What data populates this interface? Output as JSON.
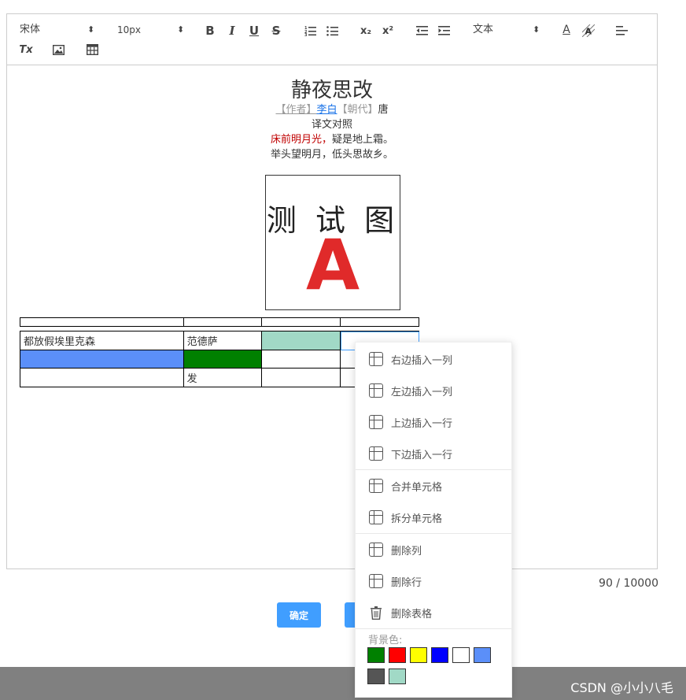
{
  "toolbar": {
    "font_family": "宋体",
    "font_size": "10px",
    "heading": "文本",
    "icons": [
      "bold-icon",
      "italic-icon",
      "underline-icon",
      "strikethrough-icon",
      "ordered-list-icon",
      "bullet-list-icon",
      "subscript-icon",
      "superscript-icon",
      "outdent-icon",
      "indent-icon",
      "font-color-icon",
      "background-color-icon",
      "align-icon",
      "clear-format-icon",
      "image-icon",
      "table-icon"
    ],
    "bold": "B",
    "italic": "I",
    "underline": "U",
    "strike": "S",
    "subscript": "x₂",
    "superscript": "x²",
    "font_color": "A",
    "clear_format": "Tx"
  },
  "content": {
    "title": "静夜思改",
    "author_label": "【作者】",
    "author": "李白",
    "dynasty_label": "【朝代】",
    "dynasty": "唐",
    "translation": "译文对照",
    "line1_red": "床前明月光，",
    "line1_rest": "疑是地上霜。",
    "line2": "举头望明月，低头思故乡。",
    "image_text": "测 试 图",
    "image_letter": "A"
  },
  "table": {
    "row1": [
      "都放假埃里克森",
      "范德萨",
      "",
      ""
    ],
    "row2": [
      "",
      "",
      "",
      ""
    ],
    "row3": [
      "",
      "发",
      "",
      ""
    ]
  },
  "counter": "90 / 10000",
  "buttons": {
    "confirm": "确定"
  },
  "context_menu": {
    "items": [
      {
        "label": "右边插入一列",
        "icon": "insert-col-right-icon"
      },
      {
        "label": "左边插入一列",
        "icon": "insert-col-left-icon"
      },
      {
        "label": "上边插入一行",
        "icon": "insert-row-above-icon"
      },
      {
        "label": "下边插入一行",
        "icon": "insert-row-below-icon"
      },
      {
        "label": "合并单元格",
        "icon": "merge-cells-icon"
      },
      {
        "label": "拆分单元格",
        "icon": "split-cells-icon"
      },
      {
        "label": "删除列",
        "icon": "delete-col-icon"
      },
      {
        "label": "删除行",
        "icon": "delete-row-icon"
      },
      {
        "label": "删除表格",
        "icon": "delete-table-icon"
      }
    ],
    "bg_label": "背景色:",
    "colors": [
      "#008000",
      "#ff0000",
      "#ffff00",
      "#0000ff",
      "#ffffff",
      "#5b8ff9",
      "#555555",
      "#a1d9c6"
    ]
  },
  "watermark": "CSDN @小小八毛",
  "colors": {
    "accent": "#409eff",
    "cell_teal": "#a1d9c6",
    "cell_blue": "#5b8ff9",
    "cell_green": "#008000",
    "red_text": "#c00000"
  }
}
